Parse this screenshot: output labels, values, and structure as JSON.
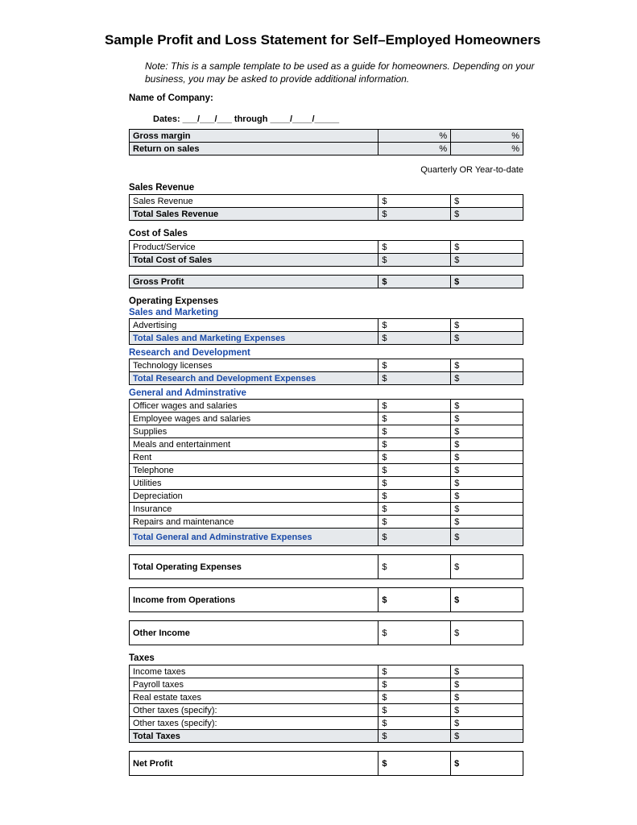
{
  "title": "Sample Profit and Loss Statement for Self–Employed Homeowners",
  "note": "Note: This is a sample template to be used as a guide for homeowners. Depending on your business, you may be asked to provide additional information.",
  "company_label": "Name of Company:",
  "dates_line": "Dates:  ___/___/___ through ____/____/_____",
  "margin_rows": [
    {
      "label": "Gross margin",
      "c1": "%",
      "c2": "%"
    },
    {
      "label": "Return on sales",
      "c1": "%",
      "c2": "%"
    }
  ],
  "period_text": "Quarterly  OR  Year-to-date",
  "currency": "$",
  "sections": {
    "sales_revenue": {
      "header": "Sales Revenue",
      "rows": [
        "Sales Revenue"
      ],
      "total": "Total Sales Revenue"
    },
    "cost_of_sales": {
      "header": "Cost of Sales",
      "rows": [
        "Product/Service"
      ],
      "total": "Total Cost of Sales"
    },
    "gross_profit": "Gross Profit",
    "op_ex_header": "Operating Expenses",
    "sales_marketing": {
      "header": "Sales and Marketing",
      "rows": [
        "Advertising"
      ],
      "total": "Total Sales and Marketing Expenses"
    },
    "rnd": {
      "header": "Research and Development",
      "rows": [
        "Technology licenses"
      ],
      "total": "Total Research and Development Expenses"
    },
    "ga": {
      "header": "General and Adminstrative",
      "rows": [
        "Officer wages and salaries",
        "Employee wages and salaries",
        "Supplies",
        "Meals and entertainment",
        "Rent",
        "Telephone",
        "Utilities",
        "Depreciation",
        "Insurance",
        "Repairs and maintenance"
      ],
      "total": "Total General and Adminstrative Expenses"
    },
    "total_opex": "Total Operating Expenses",
    "income_ops": "Income from Operations",
    "other_income": "Other Income",
    "taxes": {
      "header": "Taxes",
      "rows": [
        "Income taxes",
        "Payroll taxes",
        "Real estate taxes",
        "Other taxes (specify):",
        "Other taxes (specify):"
      ],
      "total": "Total Taxes"
    },
    "net_profit": "Net Profit"
  }
}
